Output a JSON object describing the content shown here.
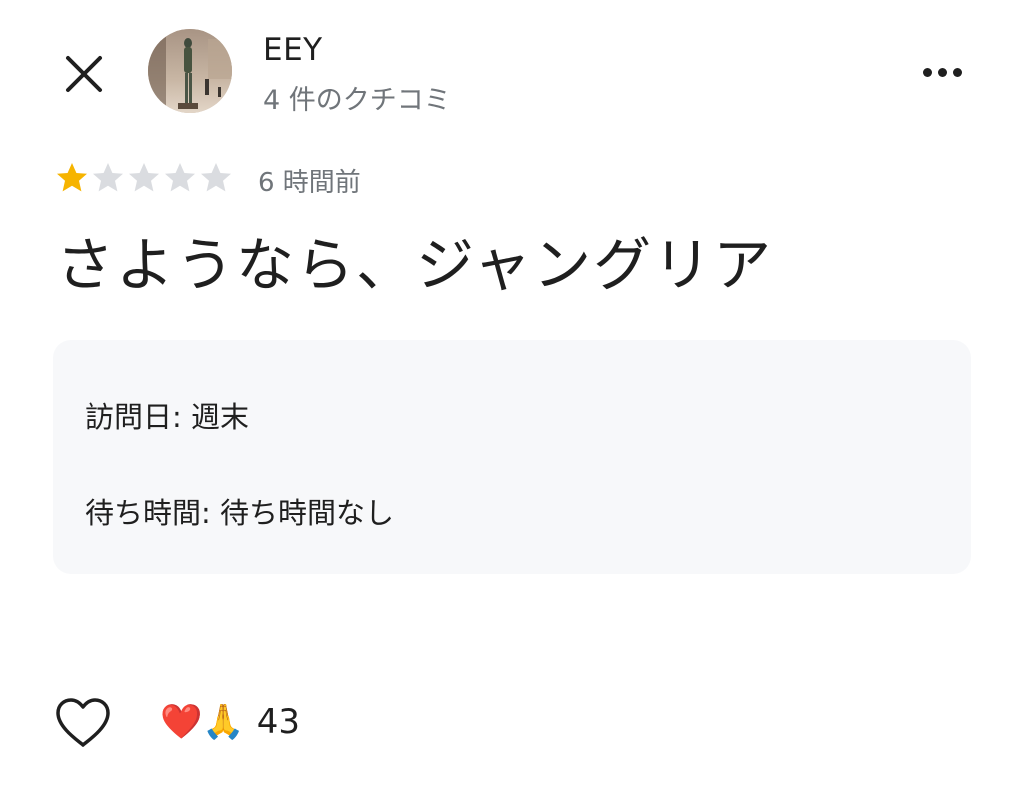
{
  "header": {
    "user_name": "EEY",
    "review_count": "4 件のクチコミ"
  },
  "review": {
    "rating": 1,
    "max_rating": 5,
    "time_ago": "6 時間前",
    "title": "さようなら、ジャングリア",
    "visit_label": "訪問日: 週末",
    "wait_label": "待ち時間: 待ち時間なし"
  },
  "reactions": {
    "emoji_heart": "❤️",
    "emoji_pray": "🙏",
    "count": "43"
  },
  "colors": {
    "star_filled": "#f6b400",
    "star_empty": "#dadce0",
    "secondary_text": "#70757a",
    "info_background": "#f7f8fa"
  },
  "icons": {
    "close": "close-icon",
    "more": "more-horizontal-icon",
    "like": "heart-outline-icon"
  }
}
